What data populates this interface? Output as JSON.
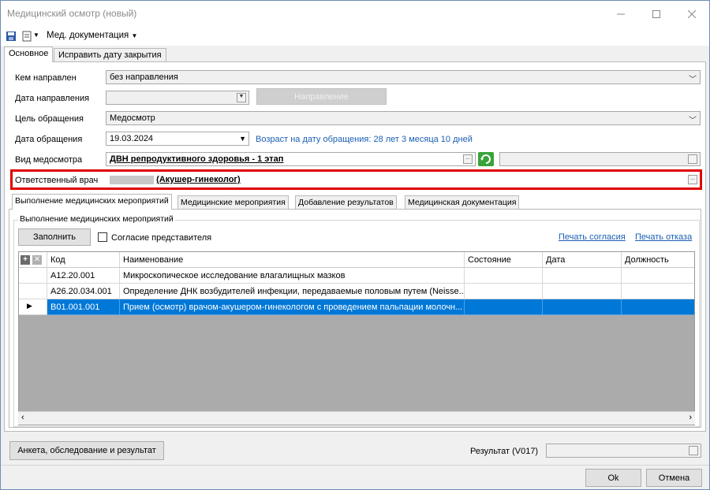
{
  "window": {
    "title": "Медицинский осмотр (новый)"
  },
  "toolbar": {
    "menu_label": "Мед. документация"
  },
  "tabs": [
    "Основное",
    "Исправить дату закрытия"
  ],
  "form": {
    "napravlen_label": "Кем направлен",
    "napravlen_value": "без направления",
    "data_napr_label": "Дата направления",
    "napr_button": "Направление",
    "cel_label": "Цель обращения",
    "cel_value": "Медосмотр",
    "data_obr_label": "Дата обращения",
    "data_obr_value": "19.03.2024",
    "age_text": "Возраст на дату обращения: 28 лет 3 месяца 10 дней",
    "vid_label": "Вид медосмотра",
    "vid_value": "ДВН репродуктивного здоровья - 1 этап",
    "vrach_label": "Ответственный врач",
    "vrach_value": "(Акушер-гинеколог)"
  },
  "subtabs": [
    "Выполнение медицинских мероприятий",
    "Медицинские мероприятия",
    "Добавление результатов",
    "Медицинская документация"
  ],
  "group": {
    "title": "Выполнение медицинских мероприятий",
    "fill_button": "Заполнить",
    "consent_label": "Согласие представителя",
    "print_consent": "Печать согласия",
    "print_refusal": "Печать отказа"
  },
  "table": {
    "columns": [
      "Код",
      "Наименование",
      "Состояние",
      "Дата",
      "Должность"
    ],
    "rows": [
      {
        "code": "A12.20.001",
        "name": "Микроскопическое исследование влагалищных мазков"
      },
      {
        "code": "A26.20.034.001",
        "name": "Определение ДНК возбудителей инфекции, передаваемые половым путем (Neisse..."
      },
      {
        "code": "B01.001.001",
        "name": "Прием (осмотр) врачом-акушером-гинекологом с проведением пальпации молочн..."
      }
    ]
  },
  "bottom": {
    "anketa_button": "Анкета, обследование и результат",
    "result_label": "Результат (V017)",
    "ok_button": "Ok",
    "cancel_button": "Отмена"
  }
}
